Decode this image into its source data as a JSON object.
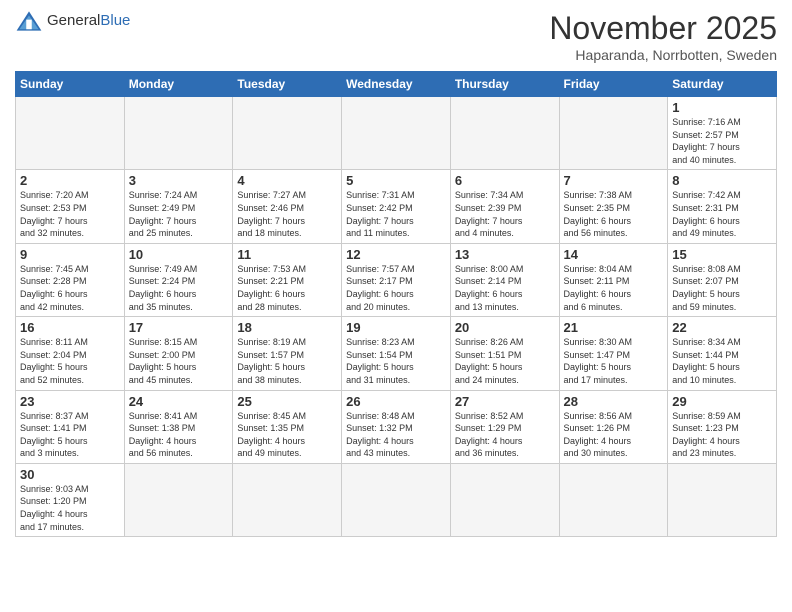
{
  "logo": {
    "text_general": "General",
    "text_blue": "Blue"
  },
  "title": "November 2025",
  "location": "Haparanda, Norrbotten, Sweden",
  "days_of_week": [
    "Sunday",
    "Monday",
    "Tuesday",
    "Wednesday",
    "Thursday",
    "Friday",
    "Saturday"
  ],
  "weeks": [
    [
      {
        "day": "",
        "empty": true
      },
      {
        "day": "",
        "empty": true
      },
      {
        "day": "",
        "empty": true
      },
      {
        "day": "",
        "empty": true
      },
      {
        "day": "",
        "empty": true
      },
      {
        "day": "",
        "empty": true
      },
      {
        "day": "1",
        "info": "Sunrise: 7:16 AM\nSunset: 2:57 PM\nDaylight: 7 hours\nand 40 minutes."
      }
    ],
    [
      {
        "day": "2",
        "info": "Sunrise: 7:20 AM\nSunset: 2:53 PM\nDaylight: 7 hours\nand 32 minutes."
      },
      {
        "day": "3",
        "info": "Sunrise: 7:24 AM\nSunset: 2:49 PM\nDaylight: 7 hours\nand 25 minutes."
      },
      {
        "day": "4",
        "info": "Sunrise: 7:27 AM\nSunset: 2:46 PM\nDaylight: 7 hours\nand 18 minutes."
      },
      {
        "day": "5",
        "info": "Sunrise: 7:31 AM\nSunset: 2:42 PM\nDaylight: 7 hours\nand 11 minutes."
      },
      {
        "day": "6",
        "info": "Sunrise: 7:34 AM\nSunset: 2:39 PM\nDaylight: 7 hours\nand 4 minutes."
      },
      {
        "day": "7",
        "info": "Sunrise: 7:38 AM\nSunset: 2:35 PM\nDaylight: 6 hours\nand 56 minutes."
      },
      {
        "day": "8",
        "info": "Sunrise: 7:42 AM\nSunset: 2:31 PM\nDaylight: 6 hours\nand 49 minutes."
      }
    ],
    [
      {
        "day": "9",
        "info": "Sunrise: 7:45 AM\nSunset: 2:28 PM\nDaylight: 6 hours\nand 42 minutes."
      },
      {
        "day": "10",
        "info": "Sunrise: 7:49 AM\nSunset: 2:24 PM\nDaylight: 6 hours\nand 35 minutes."
      },
      {
        "day": "11",
        "info": "Sunrise: 7:53 AM\nSunset: 2:21 PM\nDaylight: 6 hours\nand 28 minutes."
      },
      {
        "day": "12",
        "info": "Sunrise: 7:57 AM\nSunset: 2:17 PM\nDaylight: 6 hours\nand 20 minutes."
      },
      {
        "day": "13",
        "info": "Sunrise: 8:00 AM\nSunset: 2:14 PM\nDaylight: 6 hours\nand 13 minutes."
      },
      {
        "day": "14",
        "info": "Sunrise: 8:04 AM\nSunset: 2:11 PM\nDaylight: 6 hours\nand 6 minutes."
      },
      {
        "day": "15",
        "info": "Sunrise: 8:08 AM\nSunset: 2:07 PM\nDaylight: 5 hours\nand 59 minutes."
      }
    ],
    [
      {
        "day": "16",
        "info": "Sunrise: 8:11 AM\nSunset: 2:04 PM\nDaylight: 5 hours\nand 52 minutes."
      },
      {
        "day": "17",
        "info": "Sunrise: 8:15 AM\nSunset: 2:00 PM\nDaylight: 5 hours\nand 45 minutes."
      },
      {
        "day": "18",
        "info": "Sunrise: 8:19 AM\nSunset: 1:57 PM\nDaylight: 5 hours\nand 38 minutes."
      },
      {
        "day": "19",
        "info": "Sunrise: 8:23 AM\nSunset: 1:54 PM\nDaylight: 5 hours\nand 31 minutes."
      },
      {
        "day": "20",
        "info": "Sunrise: 8:26 AM\nSunset: 1:51 PM\nDaylight: 5 hours\nand 24 minutes."
      },
      {
        "day": "21",
        "info": "Sunrise: 8:30 AM\nSunset: 1:47 PM\nDaylight: 5 hours\nand 17 minutes."
      },
      {
        "day": "22",
        "info": "Sunrise: 8:34 AM\nSunset: 1:44 PM\nDaylight: 5 hours\nand 10 minutes."
      }
    ],
    [
      {
        "day": "23",
        "info": "Sunrise: 8:37 AM\nSunset: 1:41 PM\nDaylight: 5 hours\nand 3 minutes."
      },
      {
        "day": "24",
        "info": "Sunrise: 8:41 AM\nSunset: 1:38 PM\nDaylight: 4 hours\nand 56 minutes."
      },
      {
        "day": "25",
        "info": "Sunrise: 8:45 AM\nSunset: 1:35 PM\nDaylight: 4 hours\nand 49 minutes."
      },
      {
        "day": "26",
        "info": "Sunrise: 8:48 AM\nSunset: 1:32 PM\nDaylight: 4 hours\nand 43 minutes."
      },
      {
        "day": "27",
        "info": "Sunrise: 8:52 AM\nSunset: 1:29 PM\nDaylight: 4 hours\nand 36 minutes."
      },
      {
        "day": "28",
        "info": "Sunrise: 8:56 AM\nSunset: 1:26 PM\nDaylight: 4 hours\nand 30 minutes."
      },
      {
        "day": "29",
        "info": "Sunrise: 8:59 AM\nSunset: 1:23 PM\nDaylight: 4 hours\nand 23 minutes."
      }
    ],
    [
      {
        "day": "30",
        "info": "Sunrise: 9:03 AM\nSunset: 1:20 PM\nDaylight: 4 hours\nand 17 minutes."
      },
      {
        "day": "",
        "empty": true
      },
      {
        "day": "",
        "empty": true
      },
      {
        "day": "",
        "empty": true
      },
      {
        "day": "",
        "empty": true
      },
      {
        "day": "",
        "empty": true
      },
      {
        "day": "",
        "empty": true
      }
    ]
  ]
}
